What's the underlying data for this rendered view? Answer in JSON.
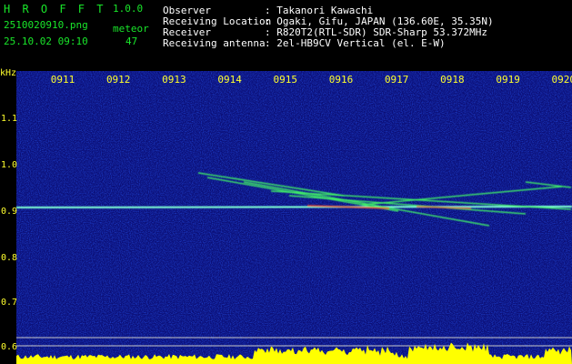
{
  "app": {
    "name": "H R O F F T",
    "version": "1.0.0"
  },
  "image": {
    "filename": "2510020910.png",
    "timestamp": "25.10.02 09:10"
  },
  "detection": {
    "label": "meteor",
    "count": "47"
  },
  "station": {
    "observer_label": "Observer",
    "observer_value": ": Takanori Kawachi",
    "location_label": "Receiving Location",
    "location_value": ": Ogaki, Gifu, JAPAN (136.60E, 35.35N)",
    "receiver_label": "Receiver",
    "receiver_value": ": R820T2(RTL-SDR) SDR-Sharp 53.372MHz",
    "antenna_label": "Receiving antenna",
    "antenna_value": ": 2el-HB9CV Vertical (el. E-W)"
  },
  "spectrogram": {
    "y_unit": "kHz",
    "time_ticks": [
      "0911",
      "0912",
      "0913",
      "0914",
      "0915",
      "0916",
      "0917",
      "0918",
      "0919",
      "0920"
    ],
    "freq_ticks": [
      "1.1",
      "1.0",
      "0.9",
      "0.8",
      "0.7",
      "0.6"
    ],
    "colors": {
      "background": "#0b0f78",
      "carrier": "#7fffd4",
      "echo": "#44ff66",
      "hot": "#ff4422",
      "activity": "#ffff00"
    }
  }
}
